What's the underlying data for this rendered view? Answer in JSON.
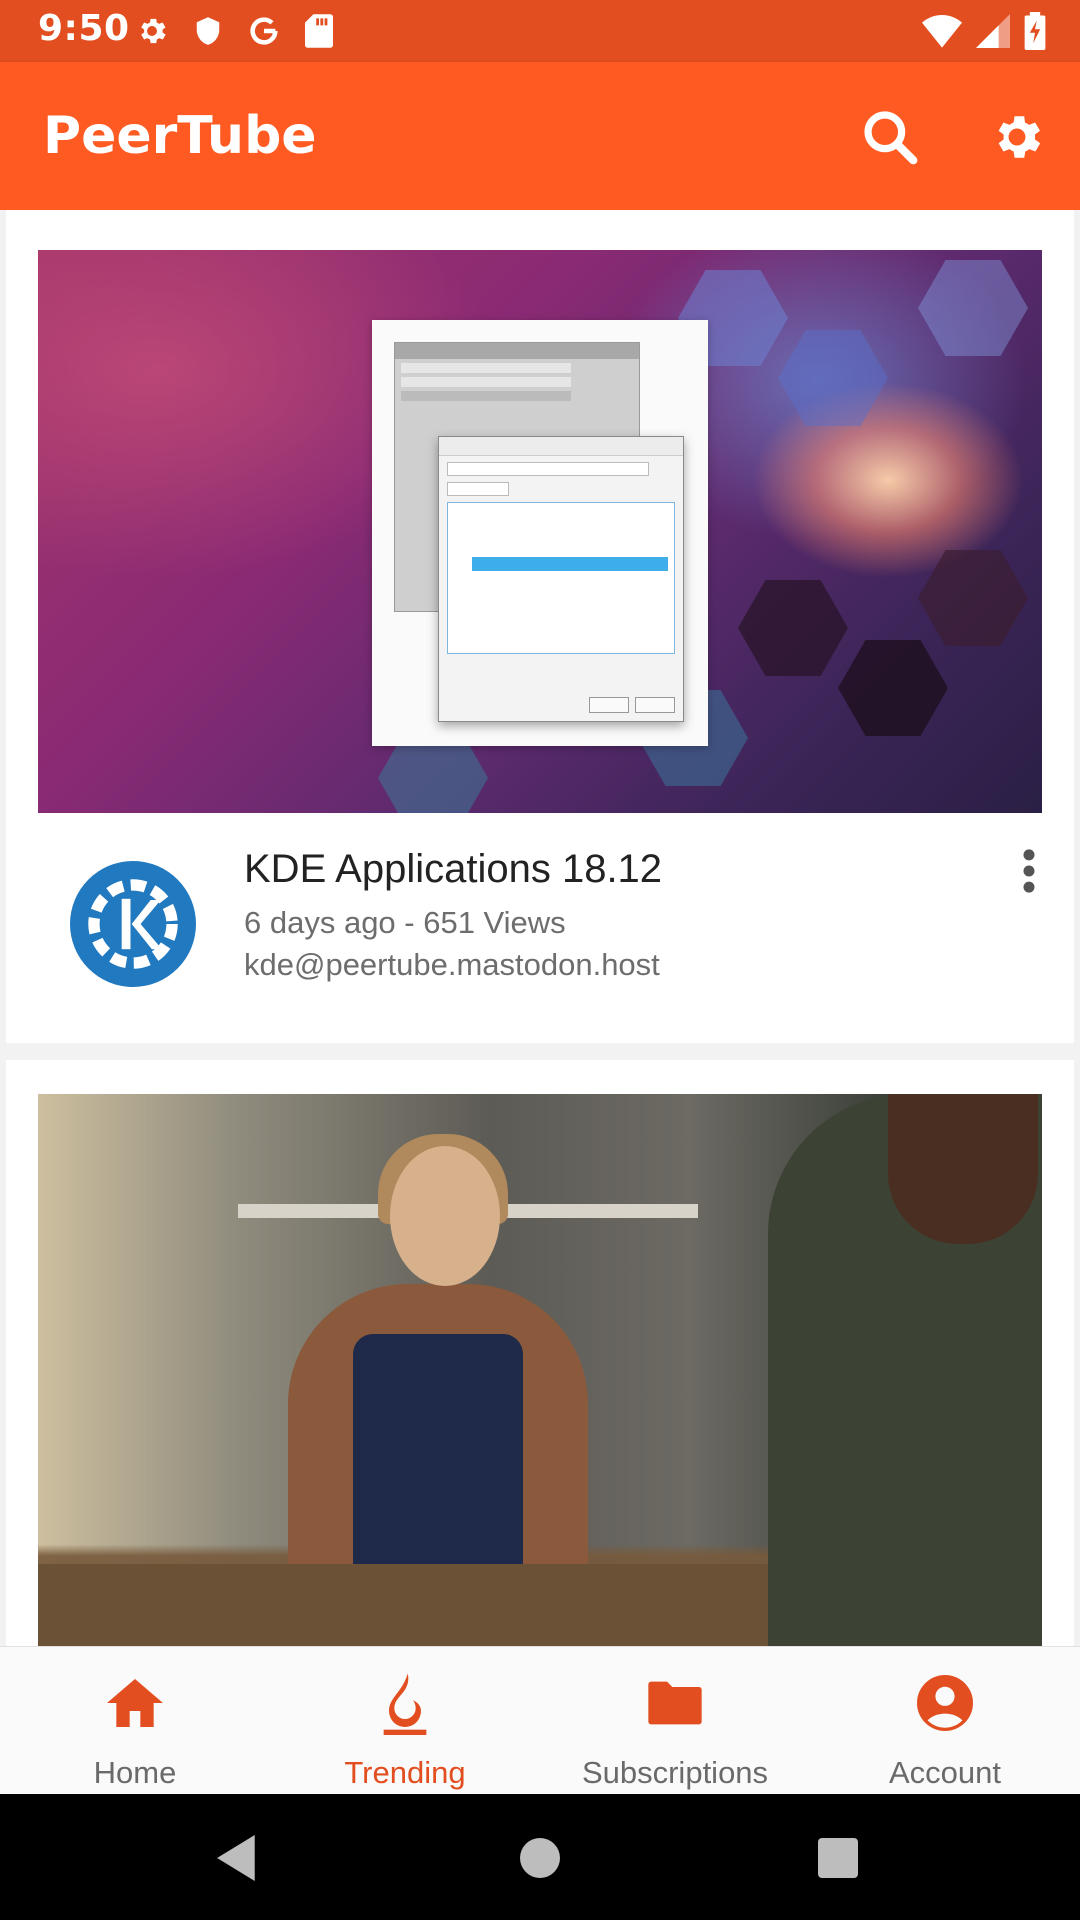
{
  "status_bar": {
    "time": "9:50",
    "left_icons": [
      "settings-icon",
      "shield-icon",
      "google-icon",
      "sd-card-icon"
    ],
    "right_icons": [
      "wifi-icon",
      "cell-signal-icon",
      "battery-icon"
    ]
  },
  "app_bar": {
    "title": "PeerTube",
    "actions": [
      "search-icon",
      "settings-icon"
    ],
    "color": "#FF5A22"
  },
  "videos": [
    {
      "title": "KDE Applications 18.12",
      "subtitle": "6 days ago - 651 Views",
      "channel": "kde@peertube.mastodon.host",
      "avatar_icon": "kde-logo-icon"
    }
  ],
  "bottom_nav": {
    "items": [
      {
        "label": "Home",
        "icon": "home-icon",
        "active": false
      },
      {
        "label": "Trending",
        "icon": "flame-icon",
        "active": true
      },
      {
        "label": "Subscriptions",
        "icon": "folder-icon",
        "active": false
      },
      {
        "label": "Account",
        "icon": "account-icon",
        "active": false
      }
    ],
    "accent": "#E24E1F"
  },
  "system_nav": [
    "back-icon",
    "home-circle-icon",
    "recents-icon"
  ]
}
